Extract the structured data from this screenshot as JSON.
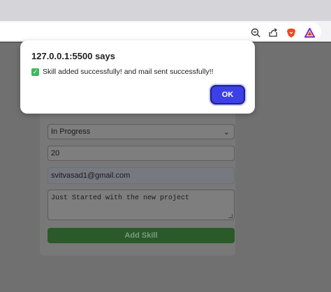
{
  "dialog": {
    "origin": "127.0.0.1:5500 says",
    "message": "Skill added successfully! and mail sent successfully!!",
    "ok_label": "OK"
  },
  "form": {
    "status_value": "In Progress",
    "progress_value": "20",
    "email_value": "svitvasad1@gmail.com",
    "notes_value": "Just Started with the new project",
    "submit_label": "Add Skill"
  },
  "colors": {
    "ok_button": "#3b41e6",
    "check_mark": "#3fb85f",
    "submit_button": "#2a5a2a"
  }
}
